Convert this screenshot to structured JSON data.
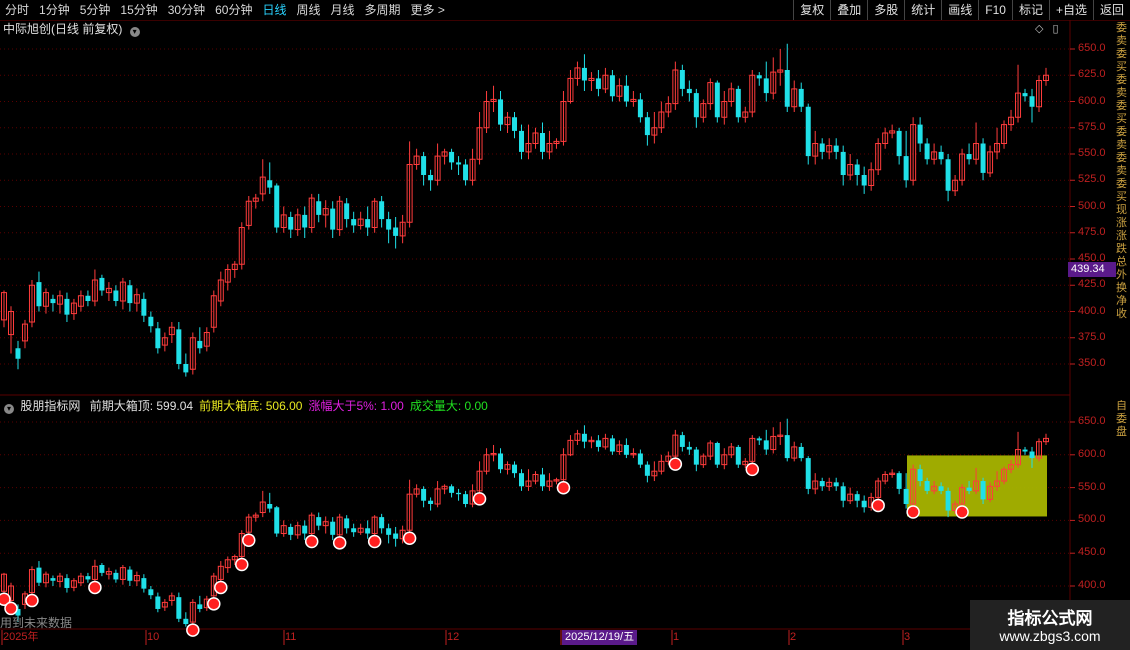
{
  "toolbar": {
    "periods": [
      "分时",
      "1分钟",
      "5分钟",
      "15分钟",
      "30分钟",
      "60分钟",
      "日线",
      "周线",
      "月线",
      "多周期",
      "更多 >"
    ],
    "active_period": "日线",
    "actions": [
      "复权",
      "叠加",
      "多股",
      "统计",
      "画线",
      "F10",
      "标记",
      "+自选",
      "返回"
    ]
  },
  "main_panel": {
    "title": "中际旭创(日线 前复权)",
    "price_ticks": [
      "650.0",
      "625.0",
      "600.0",
      "575.0",
      "550.0",
      "525.0",
      "500.0",
      "475.0",
      "450.0",
      "425.0",
      "400.0",
      "375.0",
      "350.0"
    ],
    "current_price_tag": "439.34",
    "side_text": "委卖委买委卖委买委卖委卖委买现涨涨跌总外换净收"
  },
  "indicator_panel": {
    "name": "股朋指标网",
    "fields": [
      {
        "label": "前期大箱顶:",
        "value": "599.04",
        "color": "#e0e0e0"
      },
      {
        "label": "前期大箱底:",
        "value": "506.00",
        "color": "#e8e820"
      },
      {
        "label": "涨幅大于5%:",
        "value": "1.00",
        "color": "#e020e0"
      },
      {
        "label": "成交量大:",
        "value": "0.00",
        "color": "#20e020"
      }
    ],
    "price_ticks": [
      "650.0",
      "600.0",
      "550.0",
      "500.0",
      "450.0",
      "400.0"
    ],
    "side_text": "自委盘",
    "box": {
      "top": 599.04,
      "bottom": 506.0,
      "color": "#a8b400"
    }
  },
  "date_axis": {
    "labels": [
      "2025年",
      "10",
      "11",
      "12",
      "2025/12/19/五",
      "1",
      "2",
      "3"
    ],
    "selected": "2025/12/19/五"
  },
  "hint_text": "用到未来数据",
  "watermark": {
    "line1": "指标公式网",
    "line2": "www.zbgs3.com"
  },
  "colors": {
    "up": "#ff3c3c",
    "down": "#20e0e8",
    "grid": "#5a0000",
    "axis_text": "#c02020",
    "box": "#a8b400"
  },
  "chart_data": {
    "type": "candlestick",
    "title": "中际旭创(日线 前复权)",
    "ylim": [
      335,
      660
    ],
    "candles": [
      [
        392,
        418,
        385,
        420
      ],
      [
        378,
        400,
        360,
        405
      ],
      [
        365,
        355,
        345,
        372
      ],
      [
        372,
        388,
        365,
        392
      ],
      [
        390,
        425,
        385,
        430
      ],
      [
        428,
        405,
        400,
        438
      ],
      [
        405,
        418,
        398,
        422
      ],
      [
        412,
        408,
        400,
        416
      ],
      [
        407,
        415,
        398,
        420
      ],
      [
        412,
        397,
        390,
        418
      ],
      [
        398,
        408,
        392,
        412
      ],
      [
        405,
        415,
        400,
        420
      ],
      [
        415,
        410,
        405,
        420
      ],
      [
        410,
        430,
        405,
        440
      ],
      [
        432,
        420,
        415,
        435
      ],
      [
        418,
        422,
        410,
        428
      ],
      [
        420,
        410,
        405,
        425
      ],
      [
        410,
        428,
        402,
        432
      ],
      [
        425,
        408,
        400,
        430
      ],
      [
        408,
        416,
        400,
        422
      ],
      [
        412,
        396,
        390,
        418
      ],
      [
        395,
        386,
        380,
        400
      ],
      [
        384,
        365,
        360,
        390
      ],
      [
        368,
        375,
        362,
        380
      ],
      [
        378,
        385,
        370,
        390
      ],
      [
        383,
        350,
        345,
        390
      ],
      [
        350,
        342,
        338,
        360
      ],
      [
        345,
        375,
        340,
        380
      ],
      [
        372,
        365,
        360,
        385
      ],
      [
        367,
        380,
        362,
        385
      ],
      [
        385,
        415,
        380,
        420
      ],
      [
        410,
        430,
        405,
        438
      ],
      [
        428,
        440,
        420,
        445
      ],
      [
        440,
        445,
        432,
        448
      ],
      [
        445,
        480,
        440,
        485
      ],
      [
        482,
        505,
        478,
        510
      ],
      [
        505,
        508,
        498,
        512
      ],
      [
        512,
        528,
        505,
        545
      ],
      [
        525,
        518,
        512,
        542
      ],
      [
        520,
        480,
        475,
        522
      ],
      [
        480,
        492,
        475,
        500
      ],
      [
        490,
        478,
        470,
        495
      ],
      [
        478,
        492,
        472,
        498
      ],
      [
        492,
        480,
        470,
        500
      ],
      [
        480,
        508,
        475,
        512
      ],
      [
        505,
        492,
        485,
        512
      ],
      [
        492,
        498,
        480,
        506
      ],
      [
        498,
        478,
        470,
        505
      ],
      [
        478,
        505,
        472,
        510
      ],
      [
        503,
        488,
        480,
        508
      ],
      [
        488,
        482,
        475,
        495
      ],
      [
        482,
        488,
        478,
        495
      ],
      [
        488,
        480,
        472,
        500
      ],
      [
        480,
        505,
        475,
        508
      ],
      [
        505,
        488,
        480,
        510
      ],
      [
        488,
        478,
        465,
        495
      ],
      [
        480,
        472,
        460,
        490
      ],
      [
        472,
        485,
        465,
        492
      ],
      [
        485,
        540,
        480,
        562
      ],
      [
        540,
        548,
        535,
        555
      ],
      [
        548,
        530,
        520,
        552
      ],
      [
        530,
        525,
        515,
        535
      ],
      [
        525,
        548,
        520,
        560
      ],
      [
        548,
        552,
        540,
        555
      ],
      [
        552,
        542,
        535,
        555
      ],
      [
        542,
        540,
        530,
        548
      ],
      [
        540,
        525,
        520,
        545
      ],
      [
        525,
        545,
        520,
        555
      ],
      [
        545,
        575,
        540,
        590
      ],
      [
        575,
        600,
        570,
        610
      ],
      [
        600,
        602,
        590,
        615
      ],
      [
        602,
        578,
        572,
        610
      ],
      [
        578,
        585,
        570,
        590
      ],
      [
        585,
        572,
        565,
        590
      ],
      [
        572,
        552,
        545,
        578
      ],
      [
        552,
        560,
        545,
        578
      ],
      [
        560,
        570,
        555,
        575
      ],
      [
        570,
        552,
        545,
        580
      ],
      [
        552,
        560,
        545,
        572
      ],
      [
        560,
        562,
        555,
        565
      ],
      [
        562,
        600,
        558,
        610
      ],
      [
        600,
        622,
        598,
        630
      ],
      [
        622,
        632,
        615,
        638
      ],
      [
        632,
        620,
        610,
        645
      ],
      [
        620,
        622,
        610,
        628
      ],
      [
        622,
        612,
        605,
        630
      ],
      [
        612,
        625,
        608,
        632
      ],
      [
        625,
        605,
        600,
        630
      ],
      [
        605,
        615,
        600,
        622
      ],
      [
        615,
        600,
        595,
        625
      ],
      [
        600,
        602,
        595,
        610
      ],
      [
        602,
        585,
        580,
        608
      ],
      [
        585,
        568,
        558,
        590
      ],
      [
        568,
        575,
        560,
        590
      ],
      [
        575,
        590,
        570,
        600
      ],
      [
        590,
        598,
        585,
        605
      ],
      [
        598,
        630,
        592,
        638
      ],
      [
        630,
        612,
        605,
        635
      ],
      [
        612,
        608,
        600,
        620
      ],
      [
        608,
        585,
        575,
        612
      ],
      [
        585,
        598,
        580,
        602
      ],
      [
        598,
        618,
        592,
        622
      ],
      [
        618,
        585,
        580,
        620
      ],
      [
        585,
        600,
        578,
        610
      ],
      [
        600,
        612,
        595,
        618
      ],
      [
        612,
        585,
        580,
        615
      ],
      [
        585,
        590,
        580,
        595
      ],
      [
        590,
        625,
        585,
        630
      ],
      [
        625,
        622,
        615,
        628
      ],
      [
        622,
        608,
        600,
        638
      ],
      [
        608,
        628,
        602,
        642
      ],
      [
        628,
        630,
        615,
        650
      ],
      [
        630,
        595,
        590,
        655
      ],
      [
        595,
        612,
        590,
        620
      ],
      [
        612,
        595,
        590,
        618
      ],
      [
        595,
        548,
        540,
        598
      ],
      [
        548,
        560,
        540,
        572
      ],
      [
        560,
        552,
        545,
        565
      ],
      [
        552,
        558,
        545,
        565
      ],
      [
        558,
        552,
        545,
        565
      ],
      [
        552,
        530,
        520,
        558
      ],
      [
        530,
        540,
        525,
        550
      ],
      [
        540,
        530,
        520,
        545
      ],
      [
        530,
        520,
        512,
        538
      ],
      [
        520,
        535,
        515,
        542
      ],
      [
        535,
        560,
        530,
        565
      ],
      [
        560,
        570,
        555,
        575
      ],
      [
        570,
        572,
        565,
        578
      ],
      [
        572,
        548,
        540,
        575
      ],
      [
        548,
        525,
        518,
        572
      ],
      [
        525,
        578,
        520,
        585
      ],
      [
        578,
        560,
        552,
        585
      ],
      [
        560,
        545,
        540,
        565
      ],
      [
        545,
        552,
        540,
        560
      ],
      [
        552,
        545,
        540,
        558
      ],
      [
        545,
        515,
        505,
        550
      ],
      [
        515,
        525,
        510,
        530
      ],
      [
        525,
        550,
        520,
        555
      ],
      [
        550,
        545,
        540,
        560
      ],
      [
        545,
        560,
        540,
        580
      ],
      [
        560,
        532,
        525,
        565
      ],
      [
        532,
        552,
        528,
        558
      ],
      [
        552,
        560,
        545,
        575
      ],
      [
        560,
        578,
        555,
        582
      ],
      [
        578,
        585,
        572,
        592
      ],
      [
        585,
        608,
        580,
        635
      ],
      [
        608,
        605,
        600,
        612
      ],
      [
        605,
        595,
        580,
        612
      ],
      [
        595,
        620,
        590,
        625
      ],
      [
        620,
        625,
        615,
        632
      ]
    ]
  }
}
